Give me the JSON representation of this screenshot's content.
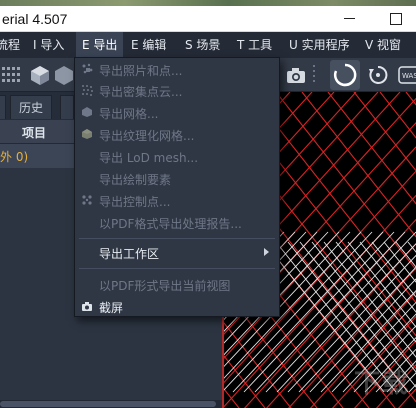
{
  "window": {
    "title": "erial 4.507"
  },
  "menubar": {
    "items": [
      {
        "label": "流程"
      },
      {
        "label": "I 导入"
      },
      {
        "label": "E 导出"
      },
      {
        "label": "E 编辑"
      },
      {
        "label": "S 场景"
      },
      {
        "label": "T 工具"
      },
      {
        "label": "U 实用程序"
      },
      {
        "label": "V 视窗"
      }
    ],
    "active_index": 2
  },
  "toolbar": {
    "icons": [
      "grid-icon",
      "cube-icon",
      "camera-icon",
      "rotate-icon",
      "refresh-icon",
      "wasd-icon"
    ],
    "wasd_label": "WAS"
  },
  "leftpanel": {
    "tabs": [
      {
        "label": "历史"
      }
    ],
    "header": "项目",
    "tree_row": "外 0)"
  },
  "export_menu": {
    "items": [
      {
        "label": "导出照片和点...",
        "icon": "photo-points-icon",
        "enabled": false
      },
      {
        "label": "导出密集点云...",
        "icon": "dense-cloud-icon",
        "enabled": false
      },
      {
        "label": "导出网格...",
        "icon": "mesh-icon",
        "enabled": false
      },
      {
        "label": "导出纹理化网格...",
        "icon": "textured-mesh-icon",
        "enabled": false
      },
      {
        "label": "导出 LoD mesh...",
        "icon": "",
        "enabled": false
      },
      {
        "label": "导出绘制要素",
        "icon": "",
        "enabled": false
      },
      {
        "label": "导出控制点...",
        "icon": "control-points-icon",
        "enabled": false
      },
      {
        "label": "以PDF格式导出处理报告...",
        "icon": "",
        "enabled": false
      },
      {
        "label": "导出工作区",
        "icon": "",
        "enabled": true,
        "submenu": true
      },
      {
        "label": "以PDF形式导出当前视图",
        "icon": "",
        "enabled": false
      },
      {
        "label": "截屏",
        "icon": "camera-icon",
        "enabled": true
      }
    ]
  },
  "colors": {
    "menu_bg": "#252b36",
    "panel_bg": "#2c3442",
    "accent_orange": "#e7b03d",
    "grid_red": "#d92424",
    "grid_white": "#e8e8e8"
  }
}
